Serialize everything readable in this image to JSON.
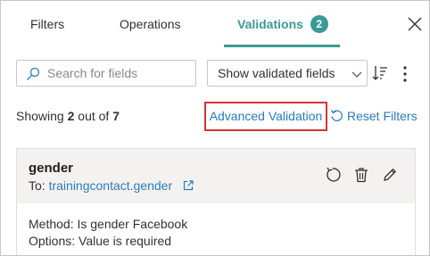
{
  "tabs": [
    {
      "label": "Filters"
    },
    {
      "label": "Operations"
    },
    {
      "label": "Validations",
      "badge": "2"
    }
  ],
  "search": {
    "placeholder": "Search for fields",
    "value": ""
  },
  "filter_select": {
    "selected": "Show validated fields"
  },
  "summary": {
    "prefix": "Showing",
    "shown": "2",
    "middle": "out of",
    "total": "7"
  },
  "actions": {
    "advanced_validation": "Advanced Validation",
    "reset_filters": "Reset Filters"
  },
  "card": {
    "title": "gender",
    "to_label": "To:",
    "to_link": "trainingcontact.gender",
    "method": "Method: Is gender Facebook",
    "options": "Options: Value is required"
  },
  "colors": {
    "accent": "#3b9a95",
    "link": "#2b7bb9",
    "highlight_border": "#d13438"
  },
  "icons": [
    "close-icon",
    "search-icon",
    "chevron-down-icon",
    "sort-icon",
    "more-icon",
    "reset-icon",
    "external-link-icon",
    "refresh-icon",
    "delete-icon",
    "edit-icon"
  ]
}
